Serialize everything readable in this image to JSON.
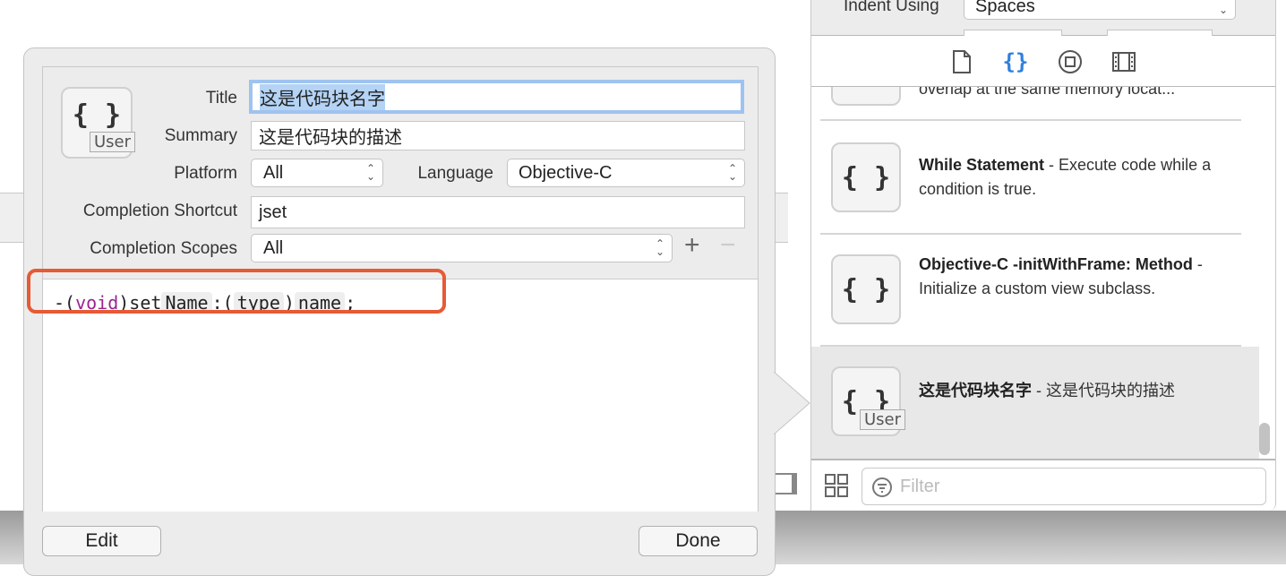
{
  "inspector": {
    "indent_label": "Indent Using",
    "indent_value": "Spaces"
  },
  "library": {
    "tabs": [
      {
        "name": "file-template",
        "icon": "document-icon"
      },
      {
        "name": "code-snippet",
        "icon": "braces-icon",
        "active": true
      },
      {
        "name": "object",
        "icon": "object-icon"
      },
      {
        "name": "media",
        "icon": "film-icon"
      }
    ],
    "items": [
      {
        "title": "",
        "desc": "overlap at the same memory locat..."
      },
      {
        "title": "While Statement",
        "desc": " - Execute code while a condition is true."
      },
      {
        "title": "Objective-C -initWithFrame: Method",
        "desc": " - Initialize a custom view subclass."
      },
      {
        "title": "这是代码块名字",
        "desc": " - 这是代码块的描述",
        "badge": "User",
        "selected": true
      }
    ],
    "filter_placeholder": "Filter"
  },
  "snippet": {
    "badge": "User",
    "title_label": "Title",
    "title_value": "这是代码块名字",
    "summary_label": "Summary",
    "summary_value": "这是代码块的描述",
    "platform_label": "Platform",
    "platform_value": "All",
    "language_label": "Language",
    "language_value": "Objective-C",
    "shortcut_label": "Completion Shortcut",
    "shortcut_value": "jset",
    "scopes_label": "Completion Scopes",
    "scopes_value": "All",
    "code": {
      "p1": "-(",
      "kw": "void",
      "p2": ")set",
      "t1": "Name",
      "p3": ":(",
      "t2": "type",
      "p4": ")",
      "t3": "name",
      "p5": ";"
    },
    "highlight_color": "#e65a35",
    "keyword_color": "#9b2393",
    "edit_label": "Edit",
    "done_label": "Done"
  }
}
